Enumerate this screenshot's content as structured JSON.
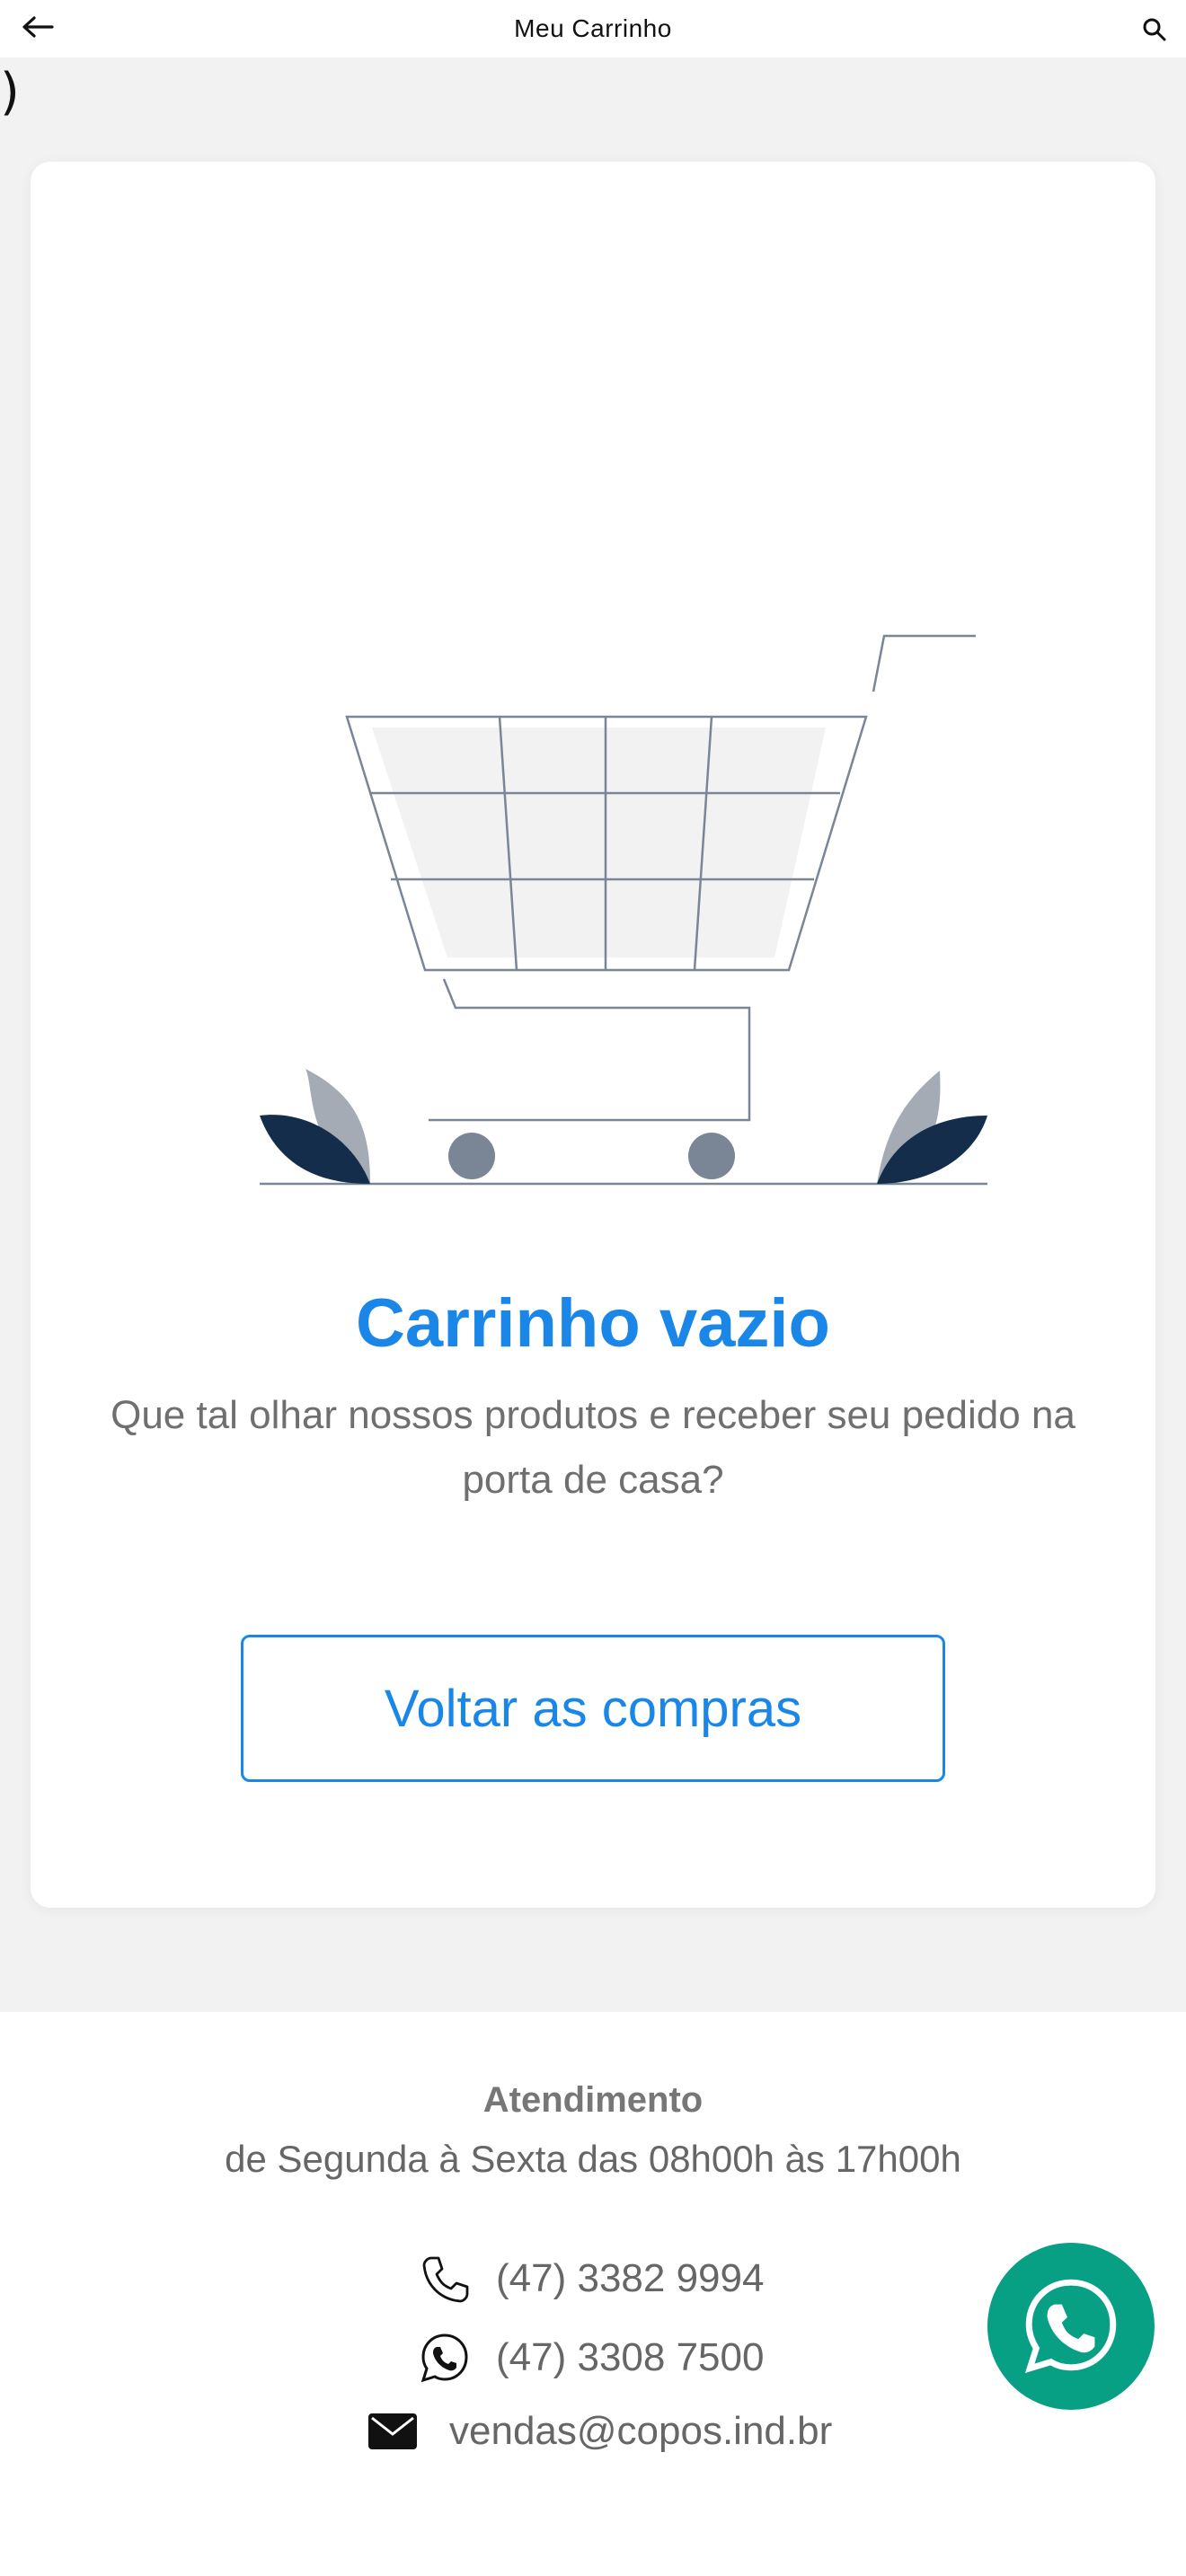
{
  "header": {
    "title": "Meu Carrinho",
    "back_icon": "arrow-left-icon",
    "search_icon": "search-icon"
  },
  "stray_text": ")",
  "empty_state": {
    "illustration": "shopping-cart-illustration",
    "title": "Carrinho vazio",
    "subtitle": "Que tal olhar nossos produtos e receber seu pedido na porta de casa?",
    "button_label": "Voltar as compras"
  },
  "footer": {
    "title": "Atendimento",
    "hours": "de Segunda à Sexta das 08h00h às 17h00h",
    "contacts": [
      {
        "icon": "phone-icon",
        "text": "(47) 3382 9994"
      },
      {
        "icon": "whatsapp-icon",
        "text": "(47) 3308 7500"
      },
      {
        "icon": "mail-icon",
        "text": "vendas@copos.ind.br"
      }
    ]
  },
  "whatsapp_fab": {
    "icon": "whatsapp-icon"
  },
  "colors": {
    "accent": "#1a87e8",
    "whatsapp": "#07a085",
    "background": "#f2f2f2",
    "text_muted": "#6f6f6f",
    "illustration_dark": "#132d4a",
    "illustration_gray": "#7a8596"
  }
}
